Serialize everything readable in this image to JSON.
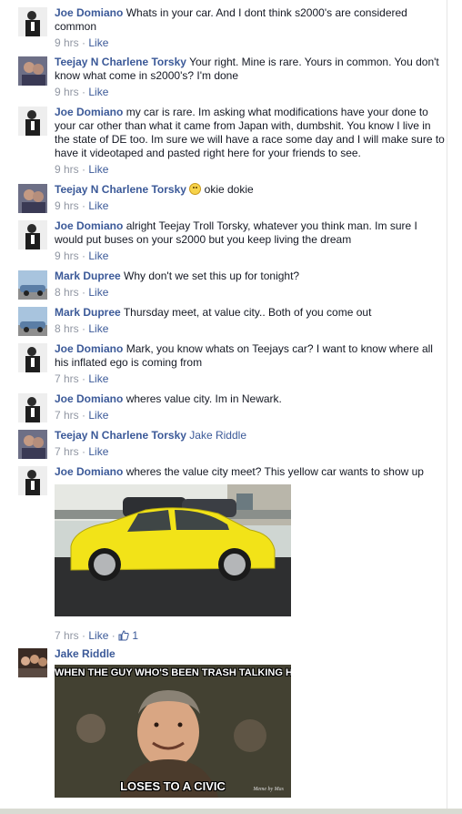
{
  "comments": [
    {
      "author": "Joe Domiano",
      "text": "Whats in your car. And I dont think s2000's are considered common",
      "time": "9 hrs",
      "like": "Like"
    },
    {
      "author": "Teejay N Charlene Torsky",
      "text": "Your right. Mine is rare. Yours in common. You don't know what come in s2000's? I'm done",
      "time": "9 hrs",
      "like": "Like"
    },
    {
      "author": "Joe Domiano",
      "text": "my car is rare. Im asking what modifications have your done to your car other than what it came from Japan with, dumbshit. You know I live in the state of DE too. Im sure we will have a race some day and I will make sure to have it videotaped and pasted right here for your friends to see.",
      "time": "9 hrs",
      "like": "Like"
    },
    {
      "author": "Teejay N Charlene Torsky",
      "text": "okie dokie",
      "time": "9 hrs",
      "like": "Like"
    },
    {
      "author": "Joe Domiano",
      "text": "alright Teejay Troll Torsky, whatever you think man. Im sure I would put buses on your s2000 but you keep living the dream",
      "time": "9 hrs",
      "like": "Like"
    },
    {
      "author": "Mark Dupree",
      "text": "Why don't we set this up for tonight?",
      "time": "8 hrs",
      "like": "Like"
    },
    {
      "author": "Mark Dupree",
      "text": "Thursday meet, at value city.. Both of you come out",
      "time": "8 hrs",
      "like": "Like"
    },
    {
      "author": "Joe Domiano",
      "text": "Mark, you know whats on Teejays car? I want to know where all his inflated ego is coming from",
      "time": "7 hrs",
      "like": "Like"
    },
    {
      "author": "Joe Domiano",
      "text": "wheres value city. Im in Newark.",
      "time": "7 hrs",
      "like": "Like"
    },
    {
      "author": "Teejay N Charlene Torsky",
      "text": "Jake Riddle",
      "time": "7 hrs",
      "like": "Like"
    },
    {
      "author": "Joe Domiano",
      "text": "wheres the value city meet? This yellow car wants to show up",
      "time": "7 hrs",
      "like": "Like",
      "like_count": "1"
    },
    {
      "author": "Jake Riddle",
      "text": "",
      "time": "",
      "like": ""
    }
  ],
  "meme": {
    "top_text": "WHEN THE GUY WHO'S BEEN TRASH TALKING HONDA",
    "bottom_text": "LOSES TO A CIVIC",
    "watermark": "Meme by Mas"
  },
  "colors": {
    "link": "#3b5998",
    "meta": "#9197a3",
    "car": "#f2e318"
  },
  "icons": {
    "smiley": "smiley-emoticon-icon",
    "thumb": "thumbs-up-icon"
  }
}
